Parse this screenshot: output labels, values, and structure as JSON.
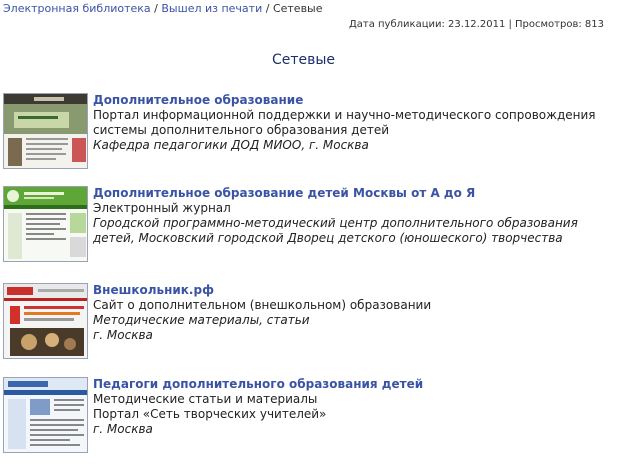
{
  "breadcrumb": {
    "items": [
      "Электронная библиотека",
      "Вышел из печати"
    ],
    "current": "Сетевые",
    "separator": "/"
  },
  "meta": {
    "text": "Дата публикации: 23.12.2011 | Просмотров: 813"
  },
  "page": {
    "title": "Сетевые"
  },
  "entries": [
    {
      "title": "Дополнительное образование",
      "lines": [
        {
          "text": "Портал информационной поддержки и научно-методического сопровождения системы дополнительного образования детей",
          "italic": false
        },
        {
          "text": "Кафедра педагогики ДОД МИОО, г. Москва",
          "italic": true
        }
      ]
    },
    {
      "title": "Дополнительное образование детей Москвы от А до Я",
      "lines": [
        {
          "text": "Электронный журнал",
          "italic": false
        },
        {
          "text": "Городской программно-методический центр дополнительного образования детей, Московский городской Дворец детского (юношеского) творчества",
          "italic": true
        }
      ]
    },
    {
      "title": "Внешкольник.рф",
      "lines": [
        {
          "text": "Сайт о дополнительном (внешкольном) образовании",
          "italic": false
        },
        {
          "text": "Методические материалы, статьи",
          "italic": true
        },
        {
          "text": "г. Москва",
          "italic": true
        }
      ]
    },
    {
      "title": "Педагоги дополнительного образования детей",
      "lines": [
        {
          "text": "Методические статьи и материалы",
          "italic": false
        },
        {
          "text": "Портал «Сеть творческих учителей»",
          "italic": false
        },
        {
          "text": "г. Москва",
          "italic": true
        }
      ]
    }
  ]
}
